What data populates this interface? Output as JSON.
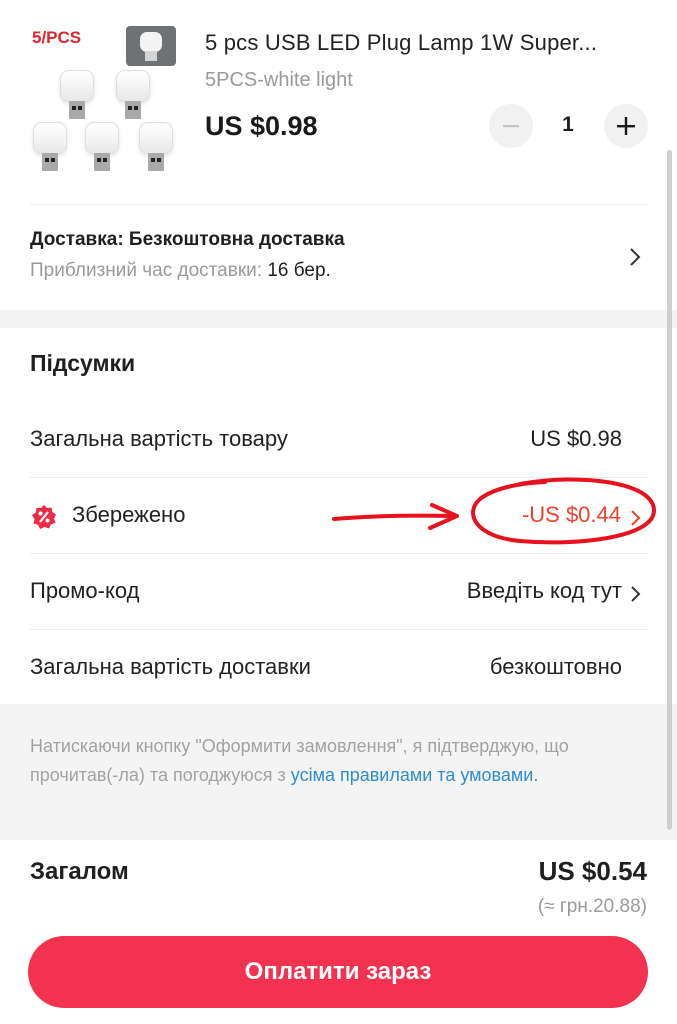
{
  "product": {
    "thumbnail_tag": "5/PCS",
    "title": "5 pcs USB LED Plug Lamp 1W Super...",
    "variant": "5PCS-white light",
    "price": "US $0.98",
    "quantity": "1",
    "minus_icon": "minus-icon",
    "plus_icon": "plus-icon"
  },
  "delivery": {
    "label": "Доставка: Безкоштовна доставка",
    "eta_label": "Приблизний час доставки:",
    "eta_value": "16 бер.",
    "chevron_icon": "chevron-right-icon"
  },
  "summary": {
    "title": "Підсумки",
    "rows": [
      {
        "label": "Загальна вартість товару",
        "value": "US $0.98"
      },
      {
        "label": "Збережено",
        "value": "-US $0.44",
        "icon": "discount-badge-icon"
      },
      {
        "label": "Промо-код",
        "value": "Введіть код тут"
      },
      {
        "label": "Загальна вартість доставки",
        "value": "безкоштовно"
      }
    ]
  },
  "notice": {
    "text": "Натискаючи кнопку \"Оформити замовлення\", я підтверджую, що прочитав(-ла) та погоджуюся з ",
    "link": "усіма правилами та умовами."
  },
  "total": {
    "label": "Загалом",
    "value": "US $0.54",
    "converted": "(≈ грн.20.88)"
  },
  "pay_button": "Оплатити зараз",
  "colors": {
    "accent": "#f2324f",
    "discount": "#f0412c",
    "link": "#2f8ccd",
    "annotation": "#e8121f"
  }
}
